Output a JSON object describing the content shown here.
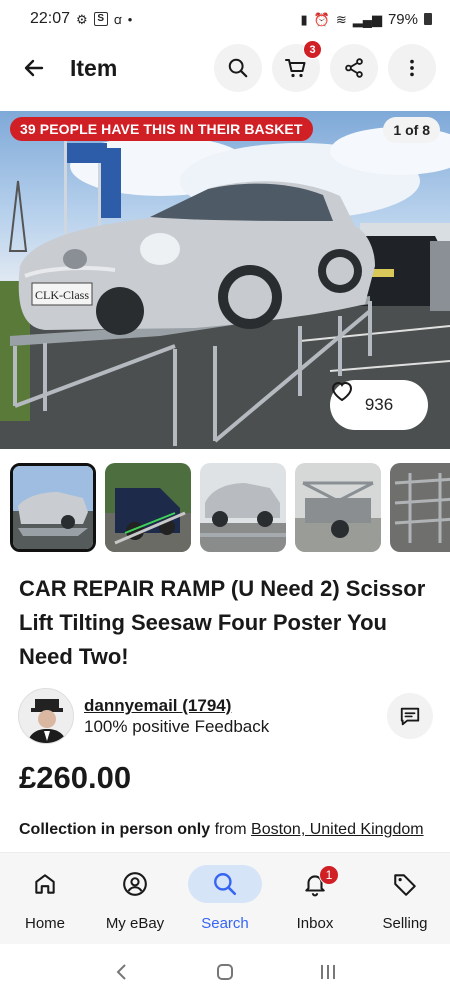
{
  "status_bar": {
    "time": "22:07",
    "left_icons": [
      "gear-icon",
      "s-app-icon",
      "air-app-icon",
      "dot-icon"
    ],
    "battery": "79%"
  },
  "header": {
    "title": "Item",
    "cart_count": "3"
  },
  "hero": {
    "basket_banner": "39 PEOPLE HAVE THIS IN THEIR BASKET",
    "image_counter": "1 of 8",
    "watch_count": "936",
    "plate_text": "CLK-Class"
  },
  "thumbnails": [
    {
      "name": "thumb-1",
      "active": true
    },
    {
      "name": "thumb-2",
      "active": false
    },
    {
      "name": "thumb-3",
      "active": false
    },
    {
      "name": "thumb-4",
      "active": false
    },
    {
      "name": "thumb-5",
      "active": false
    }
  ],
  "listing": {
    "title": "CAR REPAIR RAMP (U Need 2) Scissor Lift Tilting Seesaw Four Poster You Need Two!",
    "price": "£260.00",
    "shipping_bold": "Collection in person only",
    "shipping_from": " from ",
    "shipping_location": "Boston, United Kingdom"
  },
  "seller": {
    "name": "dannyemail (1794)",
    "feedback": "100% positive Feedback"
  },
  "bottom_nav": [
    {
      "label": "Home",
      "icon": "home-icon"
    },
    {
      "label": "My eBay",
      "icon": "user-icon"
    },
    {
      "label": "Search",
      "icon": "search-icon",
      "active": true
    },
    {
      "label": "Inbox",
      "icon": "bell-icon",
      "badge": "1"
    },
    {
      "label": "Selling",
      "icon": "tag-icon"
    }
  ],
  "colors": {
    "accent": "#3665f3",
    "badge_red": "#d11f26",
    "active_pill": "#d6e4f8"
  }
}
